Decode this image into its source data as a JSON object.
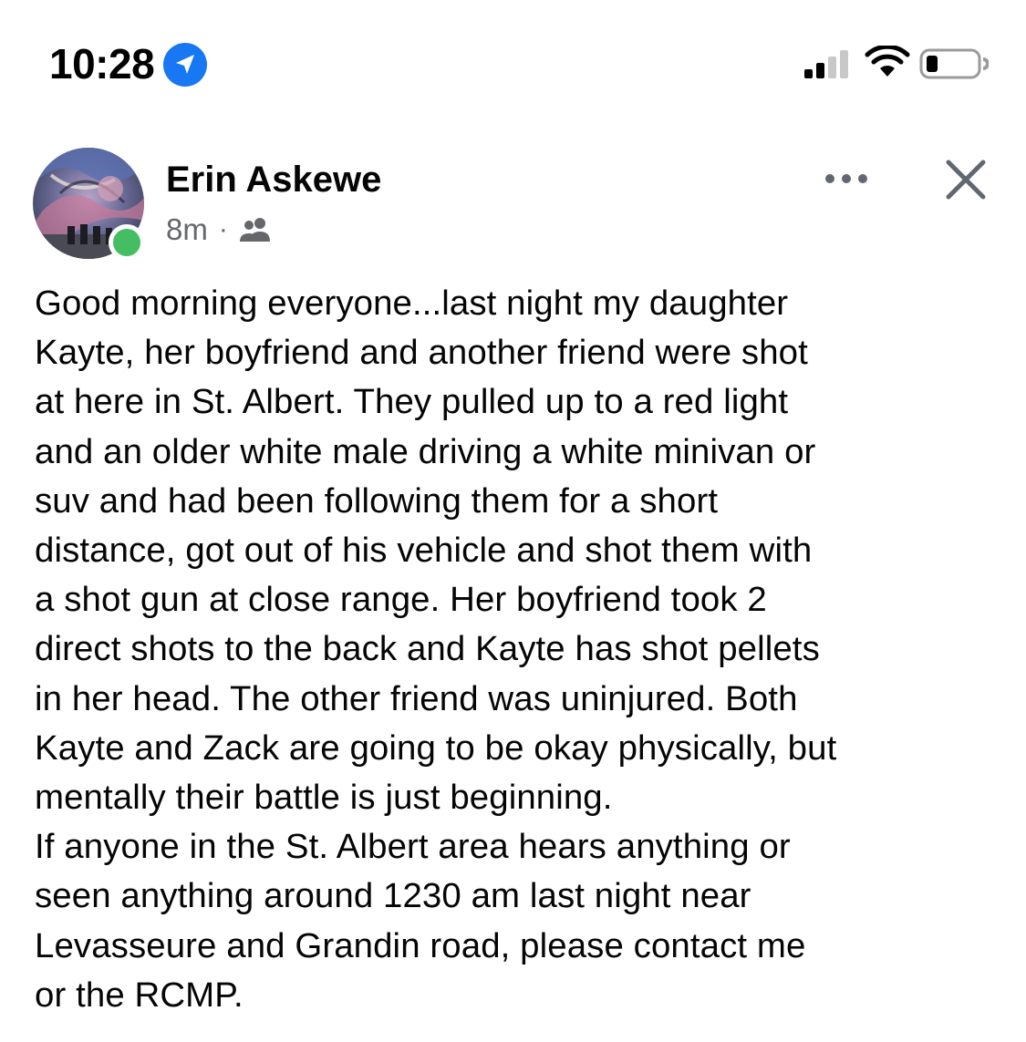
{
  "status_bar": {
    "time": "10:28",
    "icons": [
      "location-arrow-icon",
      "cellular-signal-icon",
      "wifi-icon",
      "battery-icon"
    ]
  },
  "post": {
    "author": "Erin Askewe",
    "timestamp": "8m",
    "separator": "·",
    "audience_icon": "friends-icon",
    "online": true,
    "body_lines": [
      "Good morning everyone...last night my daughter",
      "Kayte, her boyfriend and another friend were shot",
      "at here in St. Albert. They pulled up to a red light",
      "and an older white male driving a white minivan or",
      "suv and had been following them for a short",
      "distance, got out of his vehicle and shot them with",
      "a shot gun at close range. Her boyfriend took 2",
      "direct shots to the back and Kayte has shot pellets",
      "in her head. The other friend was uninjured. Both",
      "Kayte and Zack are going to be okay physically, but",
      "mentally their battle is just beginning.",
      "If anyone in the St. Albert area hears anything or",
      "seen anything around 1230 am last night near",
      "Levasseure and Grandin road, please contact me",
      "or the RCMP."
    ]
  },
  "colors": {
    "accent_blue": "#1877f2",
    "online_green": "#45bd62",
    "secondary_text": "#65676b"
  }
}
